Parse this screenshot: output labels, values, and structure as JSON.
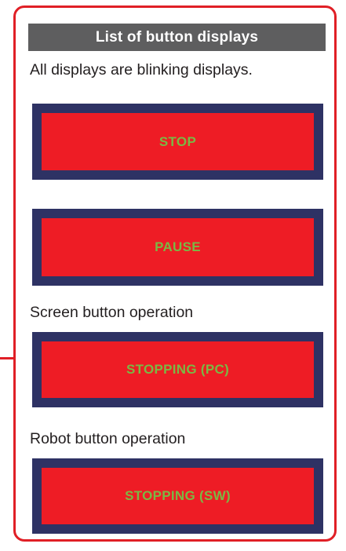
{
  "panel": {
    "title": "List of button displays",
    "subtitle": "All displays are blinking displays."
  },
  "buttons": [
    {
      "label": "STOP"
    },
    {
      "label": "PAUSE"
    },
    {
      "label": "STOPPING (PC)",
      "caption": "Screen button operation"
    },
    {
      "label": "STOPPING (SW)",
      "caption": "Robot button operation"
    }
  ],
  "colors": {
    "frame": "#e01f26",
    "header_bg": "#5e5e5f",
    "button_border": "#2e3264",
    "button_fill": "#ee1c25",
    "button_text": "#7bb844"
  }
}
